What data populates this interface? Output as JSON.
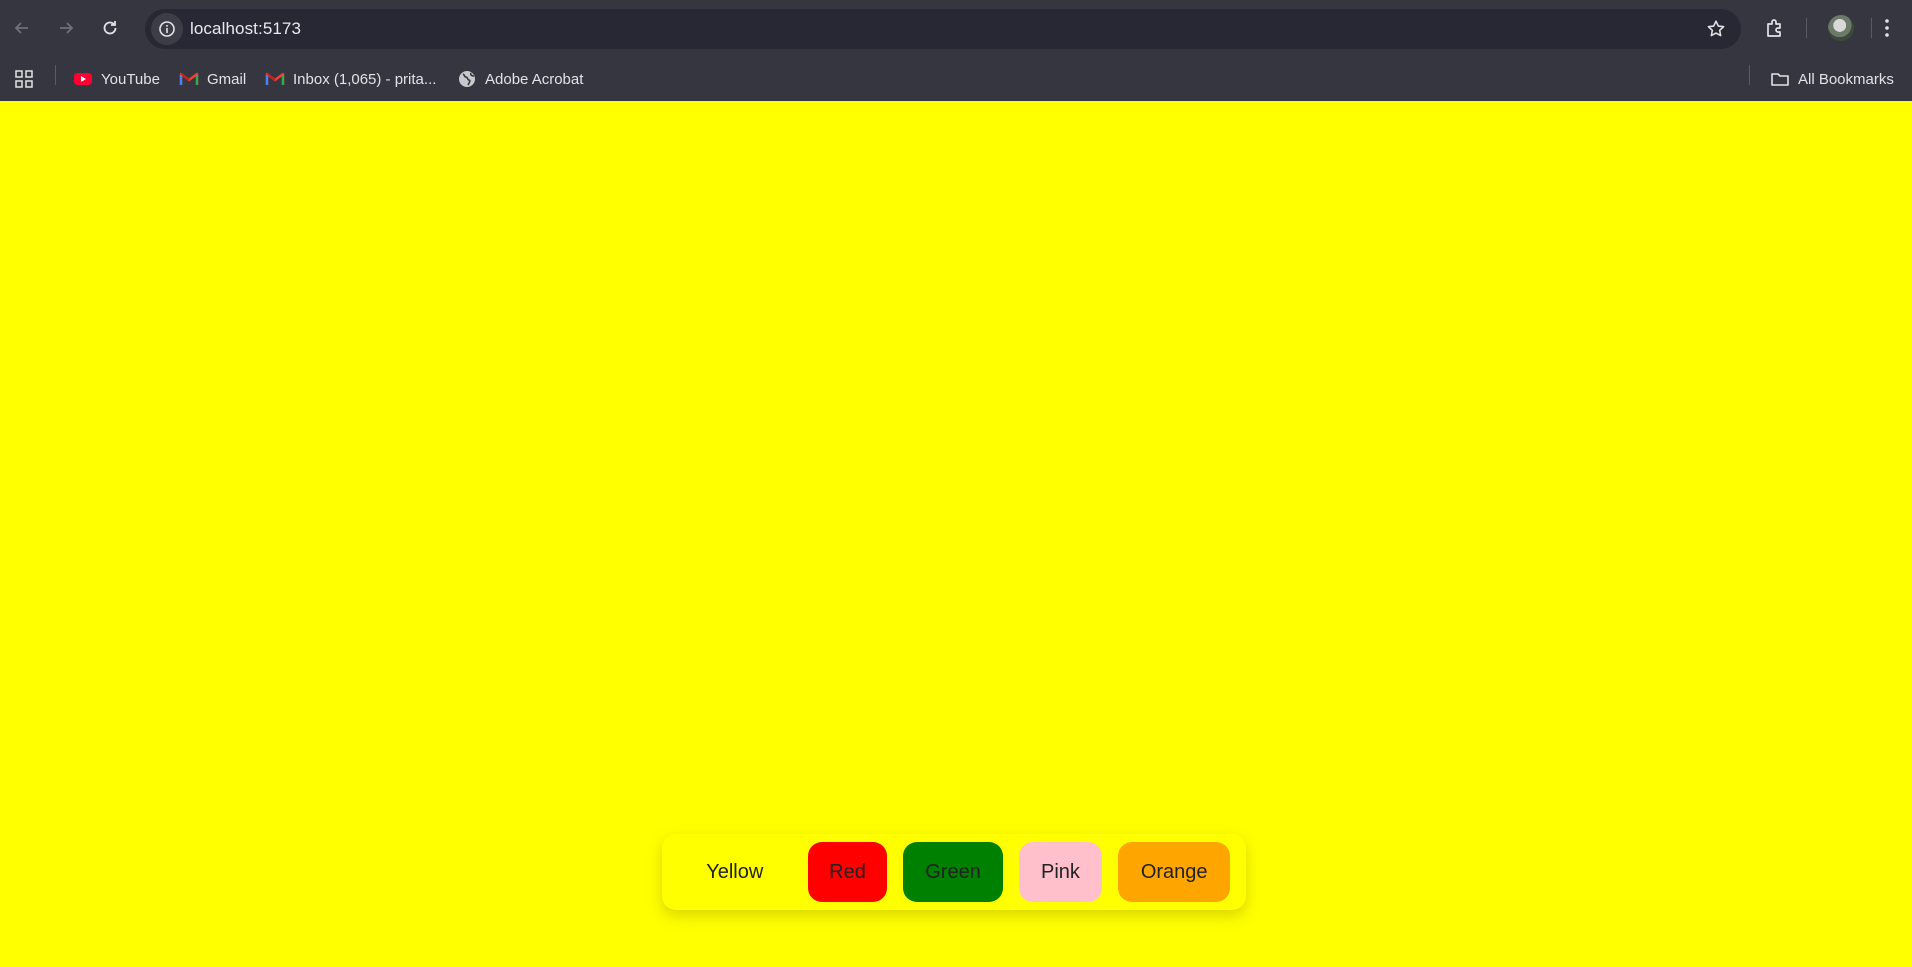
{
  "browser": {
    "url": "localhost:5173",
    "bookmarks": [
      {
        "label": "YouTube",
        "icon": "youtube-icon"
      },
      {
        "label": "Gmail",
        "icon": "gmail-icon"
      },
      {
        "label": "Inbox (1,065) - prita...",
        "icon": "gmail-icon"
      },
      {
        "label": "Adobe Acrobat",
        "icon": "globe-icon"
      }
    ],
    "all_bookmarks_label": "All Bookmarks"
  },
  "page": {
    "background_color": "#ffff00",
    "buttons": [
      {
        "label": "Yellow",
        "color": "#ffff00"
      },
      {
        "label": "Red",
        "color": "#ff0000"
      },
      {
        "label": "Green",
        "color": "#008000"
      },
      {
        "label": "Pink",
        "color": "#ffc0cb"
      },
      {
        "label": "Orange",
        "color": "#ffa500"
      }
    ]
  }
}
